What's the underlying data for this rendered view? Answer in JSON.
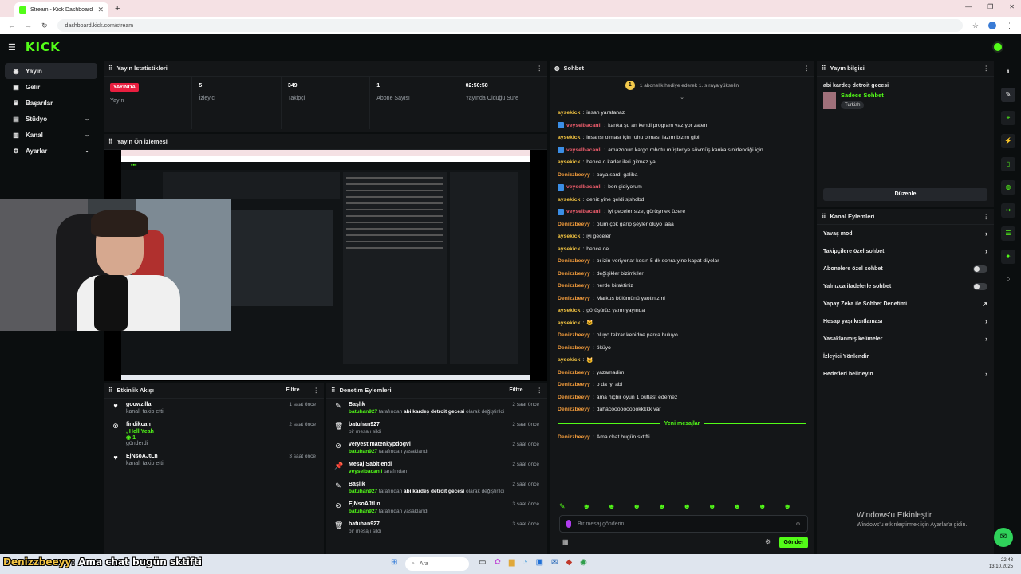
{
  "browser": {
    "tab_title": "Stream - Kick Dashboard",
    "url": "dashboard.kick.com/stream"
  },
  "brand": {
    "logo": "KICK",
    "accent": "#53fc18"
  },
  "sidebar": {
    "items": [
      {
        "label": "Yayın",
        "icon": "broadcast-icon"
      },
      {
        "label": "Gelir",
        "icon": "wallet-icon"
      },
      {
        "label": "Başarılar",
        "icon": "trophy-icon"
      },
      {
        "label": "Stüdyo",
        "icon": "studio-icon"
      },
      {
        "label": "Kanal",
        "icon": "channel-icon"
      },
      {
        "label": "Ayarlar",
        "icon": "gear-icon"
      }
    ]
  },
  "stats": {
    "title": "Yayın İstatistikleri",
    "live_badge": "YAYINDA",
    "live_label": "Yayın",
    "items": [
      {
        "value": "5",
        "label": "İzleyici"
      },
      {
        "value": "349",
        "label": "Takipçi"
      },
      {
        "value": "1",
        "label": "Abone Sayısı"
      },
      {
        "value": "02:50:58",
        "label": "Yayında Olduğu Süre"
      }
    ]
  },
  "preview": {
    "title": "Yayın Ön İzlemesi"
  },
  "activity": {
    "title": "Etkinlik Akışı",
    "filter": "Filtre",
    "items": [
      {
        "name": "goowzilla",
        "sub": "kanalı takip etti",
        "time": "1 saat önce"
      },
      {
        "name": "findikcan",
        "extra": ", Hell Yeah",
        "count": "1",
        "sub": "gönderdi",
        "time": "2 saat önce"
      },
      {
        "name": "EjNsoAJtLn",
        "sub": "kanalı takip etti",
        "time": "3 saat önce"
      }
    ]
  },
  "moderation": {
    "title": "Denetim Eylemleri",
    "filter": "Filtre",
    "items": [
      {
        "title": "Başlık",
        "actor": "batuhan927",
        "mid": " tarafından ",
        "target": "abi kardeş detroit gecesi",
        "tail": " olarak değiştirildi",
        "time": "2 saat önce"
      },
      {
        "title": "batuhan927",
        "actor": "",
        "mid": "bir mesajı sildi",
        "target": "",
        "tail": "",
        "time": "2 saat önce"
      },
      {
        "title": "veryestimatenkypdogvi",
        "actor": "batuhan927",
        "mid": " tarafından yasaklandı",
        "target": "",
        "tail": "",
        "time": "2 saat önce"
      },
      {
        "title": "Mesaj Sabitlendi",
        "actor": "veyselbacanli",
        "mid": " tarafından",
        "target": "",
        "tail": "",
        "time": "2 saat önce"
      },
      {
        "title": "Başlık",
        "actor": "batuhan927",
        "mid": " tarafından ",
        "target": "abi kardeş detroit gecesi",
        "tail": " olarak değiştirildi",
        "time": "2 saat önce"
      },
      {
        "title": "EjNsoAJtLn",
        "actor": "batuhan927",
        "mid": " tarafından yasaklandı",
        "target": "",
        "tail": "",
        "time": "3 saat önce"
      },
      {
        "title": "batuhan927",
        "actor": "",
        "mid": "bir mesajı sildi",
        "target": "",
        "tail": "",
        "time": "3 saat önce"
      }
    ]
  },
  "chat": {
    "title": "Sohbet",
    "system": "1 abonelik hediye ederek 1. sıraya yükselin",
    "messages": [
      {
        "user": "aysekick",
        "text": "insan yaratanaz",
        "cls": "u-ay",
        "badge": false
      },
      {
        "user": "veyselbacanli",
        "text": "kanka şu an kendi program yazıyor zaten",
        "cls": "u-ve",
        "badge": true
      },
      {
        "user": "aysekick",
        "text": "insansı olması için ruhu olması lazım bizim gibi",
        "cls": "u-ay",
        "badge": false
      },
      {
        "user": "veyselbacanli",
        "text": "amazonun kargo robotu müşteriye sövmüş kanka sinirlendiği için",
        "cls": "u-ve",
        "badge": true
      },
      {
        "user": "aysekick",
        "text": "bence o kadar ileri gitmez ya",
        "cls": "u-ay",
        "badge": false
      },
      {
        "user": "Denizzbeeyy",
        "text": "baya sardı galiba",
        "cls": "u-de",
        "badge": false
      },
      {
        "user": "veyselbacanli",
        "text": "ben gidiyorum",
        "cls": "u-ve",
        "badge": true
      },
      {
        "user": "aysekick",
        "text": "deniz yine geldi sjshdbd",
        "cls": "u-ay",
        "badge": false
      },
      {
        "user": "veyselbacanli",
        "text": "iyi geceler size, görüşmek üzere",
        "cls": "u-ve",
        "badge": true
      },
      {
        "user": "Denizzbeeyy",
        "text": "olum çok garip şeyler oluyo laaa",
        "cls": "u-de",
        "badge": false
      },
      {
        "user": "aysekick",
        "text": "iyi geceler",
        "cls": "u-ay",
        "badge": false
      },
      {
        "user": "aysekick",
        "text": "bence de",
        "cls": "u-ay",
        "badge": false
      },
      {
        "user": "Denizzbeeyy",
        "text": "bı izin veriyorlar kesin 5 dk sonra yine kapat diyolar",
        "cls": "u-de",
        "badge": false
      },
      {
        "user": "Denizzbeeyy",
        "text": "değişikler bizimkiler",
        "cls": "u-de",
        "badge": false
      },
      {
        "user": "Denizzbeeyy",
        "text": "nerde biraktiniz",
        "cls": "u-de",
        "badge": false
      },
      {
        "user": "Denizzbeeyy",
        "text": "Markus bölümünü yaotinizmi",
        "cls": "u-de",
        "badge": false
      },
      {
        "user": "aysekick",
        "text": "görüşürüz yarın yayında",
        "cls": "u-ay",
        "badge": false
      },
      {
        "user": "aysekick",
        "text": "",
        "cls": "u-ay",
        "badge": false
      },
      {
        "user": "Denizzbeeyy",
        "text": "oluyo tekrar kenidne parça buluyo",
        "cls": "u-de",
        "badge": false
      },
      {
        "user": "Denizzbeeyy",
        "text": "öküyo",
        "cls": "u-de",
        "badge": false
      },
      {
        "user": "aysekick",
        "text": "",
        "cls": "u-ay",
        "badge": false
      },
      {
        "user": "Denizzbeeyy",
        "text": "yazamadim",
        "cls": "u-de",
        "badge": false
      },
      {
        "user": "Denizzbeeyy",
        "text": "o da iyi abi",
        "cls": "u-de",
        "badge": false
      },
      {
        "user": "Denizzbeeyy",
        "text": "ama hiçbir oyun 1 outlast edemez",
        "cls": "u-de",
        "badge": false
      },
      {
        "user": "Denizzbeeyy",
        "text": "dahacoooooooookkkkk var",
        "cls": "u-de",
        "badge": false
      }
    ],
    "new_messages": "Yeni mesajlar",
    "latest": {
      "user": "Denizzbeeyy",
      "text": "Ama chat bugün sktifti"
    },
    "input_placeholder": "Bir mesaj gönderin",
    "send": "Gönder"
  },
  "info": {
    "title": "Yayın bilgisi",
    "stream_title": "abi kardeş detroit gecesi",
    "category": "Sadece Sohbet",
    "tag": "Turkish",
    "edit": "Düzenle"
  },
  "actions": {
    "title": "Kanal Eylemleri",
    "items": [
      {
        "label": "Yavaş mod",
        "kind": "chevron"
      },
      {
        "label": "Takipçilere özel sohbet",
        "kind": "chevron"
      },
      {
        "label": "Abonelere özel sohbet",
        "kind": "toggle"
      },
      {
        "label": "Yalnızca ifadelerle sohbet",
        "kind": "toggle"
      },
      {
        "label": "Yapay Zeka ile Sohbet Denetimi",
        "kind": "external"
      },
      {
        "label": "Hesap yaşı kısıtlaması",
        "kind": "chevron"
      },
      {
        "label": "Yasaklanmış kelimeler",
        "kind": "chevron"
      },
      {
        "label": "İzleyici Yönlendir",
        "kind": "none"
      },
      {
        "label": "Hedefleri belirleyin",
        "kind": "chevron"
      }
    ]
  },
  "windows": {
    "activate_title": "Windows'u Etkinleştir",
    "activate_sub": "Windows'u etkinleştirmek için Ayarlar'a gidin.",
    "search": "Ara",
    "time": "22:48",
    "date": "13.10.2025"
  },
  "caption": {
    "user": "Denizzbeeyy",
    "text": ": Ama chat bugün sktifti"
  }
}
